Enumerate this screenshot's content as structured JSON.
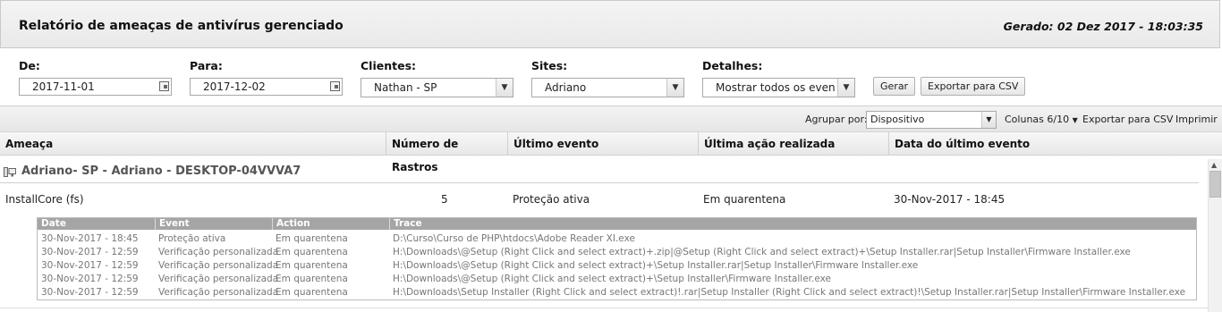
{
  "header": {
    "title": "Relatório de ameaças de antivírus gerenciado",
    "generated": "Gerado: 02 Dez 2017 - 18:03:35"
  },
  "filters": {
    "from_label": "De:",
    "from_value": "2017-11-01",
    "to_label": "Para:",
    "to_value": "2017-12-02",
    "clients_label": "Clientes:",
    "clients_value": "Nathan - SP",
    "sites_label": "Sites:",
    "sites_value": "Adriano",
    "details_label": "Detalhes:",
    "details_value": "Mostrar todos os even",
    "generate_button": "Gerar",
    "export_button": "Exportar para CSV"
  },
  "toolbar": {
    "group_by_label": "Agrupar por:",
    "group_by_value": "Dispositivo",
    "columns_label": "Colunas 6/10",
    "export_label": "Exportar para CSV",
    "print_label": "Imprimir"
  },
  "columns": [
    "Ameaça",
    "Número de Rastros",
    "Último evento",
    "Última ação realizada",
    "Data do último evento"
  ],
  "group": {
    "title": "Adriano- SP - Adriano - DESKTOP-04VVVA7"
  },
  "row": {
    "threat": "InstallCore (fs)",
    "traces": "5",
    "last_event": "Proteção ativa",
    "last_action": "Em quarentena",
    "last_date": "30-Nov-2017 - 18:45"
  },
  "subtable": {
    "headers": [
      "Date",
      "Event",
      "Action",
      "Trace"
    ],
    "rows": [
      [
        "30-Nov-2017 - 18:45",
        "Proteção ativa",
        "Em quarentena",
        "D:\\Curso\\Curso de PHP\\htdocs\\Adobe Reader XI.exe"
      ],
      [
        "30-Nov-2017 - 12:59",
        "Verificação personalizada",
        "Em quarentena",
        "H:\\Downloads\\@Setup (Right Click and select extract)+.zip|@Setup (Right Click and select extract)+\\Setup Installer.rar|Setup Installer\\Firmware Installer.exe"
      ],
      [
        "30-Nov-2017 - 12:59",
        "Verificação personalizada",
        "Em quarentena",
        "H:\\Downloads\\@Setup (Right Click and select extract)+\\Setup Installer.rar|Setup Installer\\Firmware Installer.exe"
      ],
      [
        "30-Nov-2017 - 12:59",
        "Verificação personalizada",
        "Em quarentena",
        "H:\\Downloads\\@Setup (Right Click and select extract)+\\Setup Installer\\Firmware Installer.exe"
      ],
      [
        "30-Nov-2017 - 12:59",
        "Verificação personalizada",
        "Em quarentena",
        "H:\\Downloads\\Setup Installer (Right Click and select extract)!.rar|Setup Installer (Right Click and select extract)!\\Setup Installer.rar|Setup Installer\\Firmware Installer.exe"
      ]
    ]
  }
}
